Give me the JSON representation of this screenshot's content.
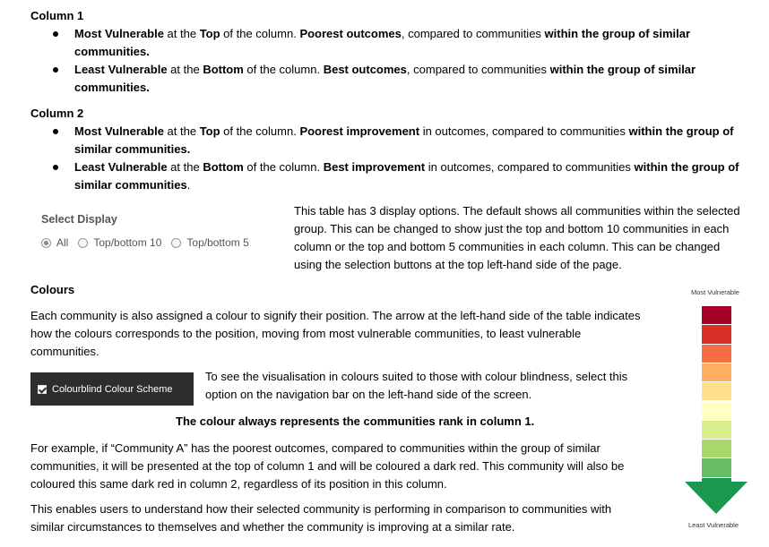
{
  "column1": {
    "heading": "Column 1",
    "bullets": [
      {
        "b1": "Most Vulnerable",
        "t1": " at the ",
        "b2": "Top",
        "t2": " of the column. ",
        "b3": "Poorest outcomes",
        "t3": ", compared to communities ",
        "b4": "within the group of similar",
        "line2": "communities."
      },
      {
        "b1": "Least Vulnerable",
        "t1": " at the ",
        "b2": "Bottom",
        "t2": " of the column. ",
        "b3": "Best outcomes",
        "t3": ", compared to communities ",
        "b4": "within the group of similar",
        "line2": "communities."
      }
    ]
  },
  "column2": {
    "heading": "Column 2",
    "bullets": [
      {
        "b1": "Most Vulnerable",
        "t1": " at the ",
        "b2": "Top",
        "t2": " of the column. ",
        "b3": "Poorest improvement",
        "t3": " in outcomes, compared to communities ",
        "b4": "within the group of",
        "line2": "similar communities."
      },
      {
        "b1": "Least Vulnerable",
        "t1": " at the ",
        "b2": "Bottom",
        "t2": " of the column. ",
        "b3": "Best improvement",
        "t3": " in outcomes, compared to communities ",
        "b4": "within the group of",
        "line2": "similar communities",
        "line2_tail": "."
      }
    ]
  },
  "select_display": {
    "title": "Select Display",
    "options": [
      "All",
      "Top/bottom 10",
      "Top/bottom 5"
    ],
    "selected": "All"
  },
  "display_text": [
    "This table has 3 display options. The default shows all communities within the selected",
    "group. This can be changed to show just the top and bottom 10 communities in each",
    "column or the top and bottom 5 communities in each column. This can be changed",
    "using the selection buttons at the top left-hand side of the page."
  ],
  "colours": {
    "heading": "Colours",
    "para1": [
      "Each community is also assigned a colour to signify their position. The arrow at the left-hand side of the table indicates",
      "how the colours corresponds to the position, moving from most vulnerable communities, to least vulnerable",
      "communities."
    ],
    "colourblind_button": "Colourblind Colour Scheme",
    "colourblind_text": [
      "To see the visualisation in colours suited to those with colour blindness, select this",
      "option on the navigation bar on the left-hand side of the screen."
    ],
    "bold_note": "The colour always represents the communities rank in column 1.",
    "para2": [
      "For example, if “Community A” has the poorest outcomes, compared to communities within the group of similar",
      "communities, it will be presented at the top of column 1 and will be coloured a dark red. This community will also be",
      "coloured this same dark red in column 2, regardless of its position in this column."
    ],
    "para3": [
      "This enables users to understand how their selected community is performing in comparison to communities with",
      "similar circumstances to themselves and whether the community is improving at a similar rate."
    ]
  },
  "scale": {
    "top_label": "Most Vulnerable",
    "bottom_label": "Least Vulnerable",
    "colors": [
      "#a50026",
      "#d73027",
      "#f46d43",
      "#fdae61",
      "#fee08b",
      "#ffffbf",
      "#d9ef8b",
      "#a6d96a",
      "#66bd63",
      "#1a9850"
    ],
    "arrow_color": "#1a9850"
  }
}
